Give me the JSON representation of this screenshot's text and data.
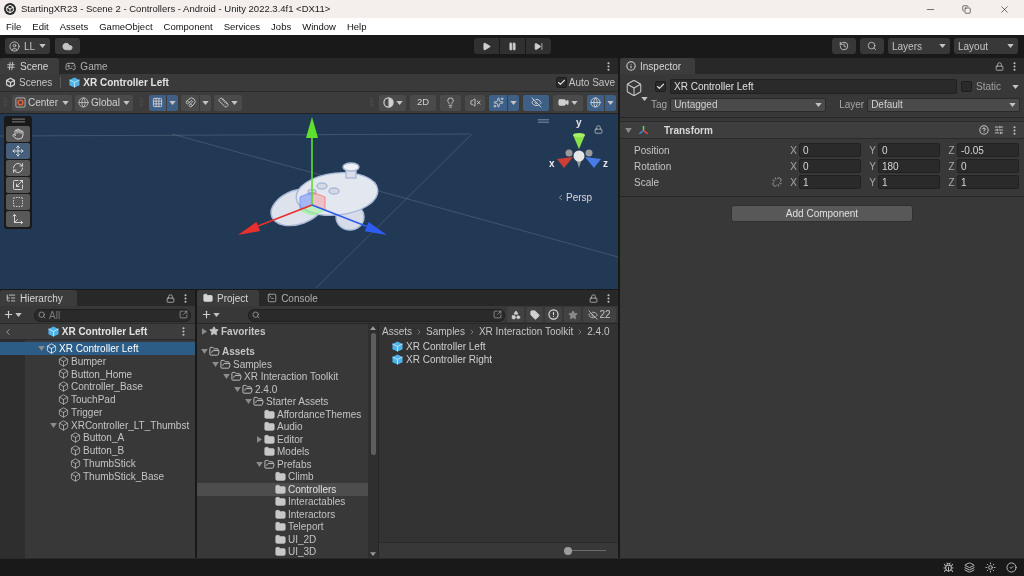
{
  "window": {
    "title": "StartingXR23 - Scene 2 - Controllers - Android - Unity 2022.3.4f1 <DX11>"
  },
  "menu": [
    "File",
    "Edit",
    "Assets",
    "GameObject",
    "Component",
    "Services",
    "Jobs",
    "Window",
    "Help"
  ],
  "toolbar": {
    "account": "LL",
    "layers": "Layers",
    "layout": "Layout"
  },
  "scene": {
    "tabs": [
      {
        "label": "Scene",
        "kind": "scene",
        "selected": true
      },
      {
        "label": "Game",
        "kind": "game",
        "selected": false
      }
    ],
    "breadcrumb": {
      "root": "Scenes",
      "current": "XR Controller Left"
    },
    "auto_save": {
      "label": "Auto Save",
      "checked": true
    },
    "pivot": "Center",
    "space": "Global",
    "snap_tools": [
      {
        "kind": "grid",
        "on": true
      },
      {
        "kind": "snap",
        "on": false
      },
      {
        "kind": "increment",
        "on": false
      }
    ],
    "view_tools": [
      {
        "kind": "shading",
        "on": false
      },
      {
        "kind": "mode2d",
        "label": "2D",
        "on": false
      },
      {
        "kind": "lighting",
        "on": false
      },
      {
        "kind": "audio",
        "on": false
      },
      {
        "kind": "effects",
        "on": true
      },
      {
        "kind": "hidden",
        "on": true
      },
      {
        "kind": "camera",
        "on": false
      },
      {
        "kind": "gizmos",
        "on": true
      }
    ],
    "tools": [
      {
        "kind": "hand",
        "selected": false
      },
      {
        "kind": "move",
        "selected": true
      },
      {
        "kind": "rotate",
        "selected": false
      },
      {
        "kind": "scale",
        "selected": false
      },
      {
        "kind": "rect",
        "selected": false
      },
      {
        "kind": "transform",
        "selected": false
      }
    ],
    "axes": {
      "x": "x",
      "y": "y",
      "z": "z"
    },
    "projection": "Persp"
  },
  "inspector": {
    "tab": "Inspector",
    "object": {
      "active": true,
      "name": "XR Controller Left",
      "static": false,
      "static_label": "Static",
      "tag_label": "Tag",
      "tag": "Untagged",
      "layer_label": "Layer",
      "layer": "Default"
    },
    "transform": {
      "title": "Transform",
      "expanded": true,
      "rows": [
        {
          "label": "Position",
          "fields": [
            {
              "axis": "X",
              "value": "0"
            },
            {
              "axis": "Y",
              "value": "0"
            },
            {
              "axis": "Z",
              "value": "-0.05"
            }
          ]
        },
        {
          "label": "Rotation",
          "fields": [
            {
              "axis": "X",
              "value": "0"
            },
            {
              "axis": "Y",
              "value": "180"
            },
            {
              "axis": "Z",
              "value": "0"
            }
          ]
        },
        {
          "label": "Scale",
          "linked": false,
          "fields": [
            {
              "axis": "X",
              "value": "1"
            },
            {
              "axis": "Y",
              "value": "1"
            },
            {
              "axis": "Z",
              "value": "1"
            }
          ]
        }
      ]
    },
    "add_button": "Add Component"
  },
  "hierarchy": {
    "tab": "Hierarchy",
    "search": {
      "placeholder": "All"
    },
    "prefab": "XR Controller Left",
    "tree": [
      {
        "label": "XR Controller Left",
        "selected": true,
        "expanded": true,
        "children": [
          {
            "label": "Bumper",
            "selected": false
          },
          {
            "label": "Button_Home",
            "selected": false
          },
          {
            "label": "Controller_Base",
            "selected": false
          },
          {
            "label": "TouchPad",
            "selected": false
          },
          {
            "label": "Trigger",
            "selected": false
          },
          {
            "label": "XRController_LT_Thumbst",
            "selected": false,
            "expanded": true,
            "children": [
              {
                "label": "Button_A",
                "selected": false
              },
              {
                "label": "Button_B",
                "selected": false
              },
              {
                "label": "ThumbStick",
                "selected": false
              },
              {
                "label": "ThumbStick_Base",
                "selected": false
              }
            ]
          }
        ]
      }
    ]
  },
  "project": {
    "tabs": [
      {
        "label": "Project",
        "kind": "project",
        "selected": true
      },
      {
        "label": "Console",
        "kind": "console",
        "selected": false
      }
    ],
    "hidden_count": "22",
    "tree": [
      {
        "label": "Favorites",
        "kind": "favorites",
        "selected": false,
        "expanded": false
      },
      {
        "label": "Assets",
        "kind": "folder",
        "selected": false,
        "expanded": true,
        "children": [
          {
            "label": "Samples",
            "kind": "folder",
            "selected": false,
            "expanded": true,
            "children": [
              {
                "label": "XR Interaction Toolkit",
                "kind": "folder",
                "selected": false,
                "expanded": true,
                "children": [
                  {
                    "label": "2.4.0",
                    "kind": "folder",
                    "selected": false,
                    "expanded": true,
                    "children": [
                      {
                        "label": "Starter Assets",
                        "kind": "folder",
                        "selected": false,
                        "expanded": true,
                        "children": [
                          {
                            "label": "AffordanceThemes",
                            "kind": "folder",
                            "selected": false
                          },
                          {
                            "label": "Audio",
                            "kind": "folder",
                            "selected": false
                          },
                          {
                            "label": "Editor",
                            "kind": "folder",
                            "selected": false,
                            "expanded": false
                          },
                          {
                            "label": "Models",
                            "kind": "folder",
                            "selected": false
                          },
                          {
                            "label": "Prefabs",
                            "kind": "folder",
                            "selected": false,
                            "expanded": true,
                            "children": [
                              {
                                "label": "Climb",
                                "kind": "folder",
                                "selected": false
                              },
                              {
                                "label": "Controllers",
                                "kind": "folder",
                                "selected": true
                              },
                              {
                                "label": "Interactables",
                                "kind": "folder",
                                "selected": false
                              },
                              {
                                "label": "Interactors",
                                "kind": "folder",
                                "selected": false
                              },
                              {
                                "label": "Teleport",
                                "kind": "folder",
                                "selected": false
                              },
                              {
                                "label": "UI_2D",
                                "kind": "folder",
                                "selected": false
                              },
                              {
                                "label": "UI_3D",
                                "kind": "folder",
                                "selected": false
                              }
                            ]
                          }
                        ]
                      }
                    ]
                  }
                ]
              }
            ]
          }
        ]
      }
    ],
    "path": [
      "Assets",
      "Samples",
      "XR Interaction Toolkit",
      "2.4.0"
    ],
    "assets": [
      "XR Controller Left",
      "XR Controller Right"
    ],
    "icon_size": {
      "level": 0
    }
  }
}
